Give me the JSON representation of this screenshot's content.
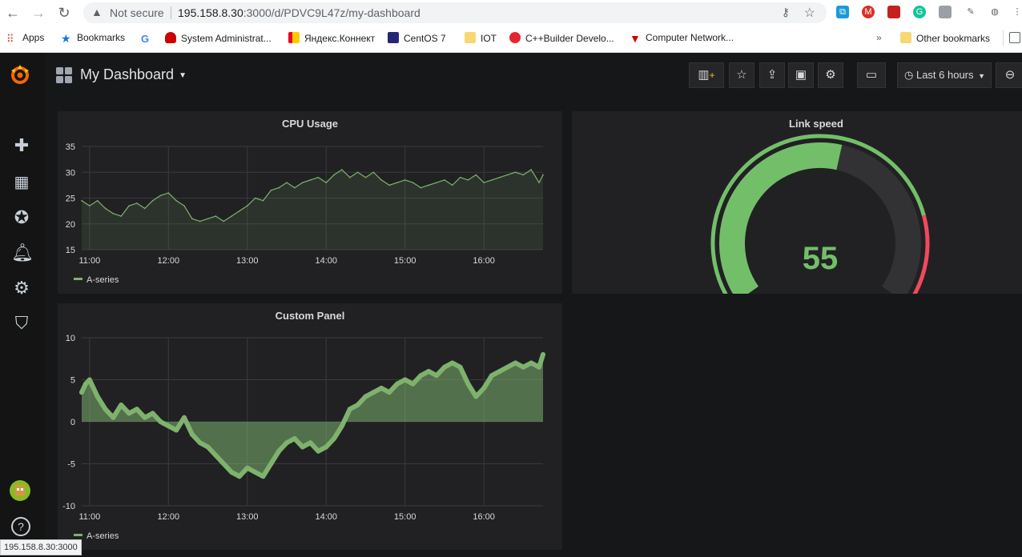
{
  "browser": {
    "security_label": "Not secure",
    "url_host": "195.158.8.30",
    "url_rest": ":3000/d/PDVC9L47z/my-dashboard",
    "bookmarks": [
      {
        "label": "Apps",
        "icon": "apps-grid-icon",
        "color": "#e8453c"
      },
      {
        "label": "Bookmarks",
        "icon": "star-icon",
        "color": "#1a73e8"
      },
      {
        "label": "",
        "icon": "google-icon",
        "color": "#4285f4"
      },
      {
        "label": "System Administrat...",
        "icon": "redhat-icon",
        "color": "#cc0000"
      },
      {
        "label": "Яндекс.Коннект",
        "icon": "yandex-icon",
        "color": "#ffcc00"
      },
      {
        "label": "CentOS 7",
        "icon": "centos-icon",
        "color": "#262577"
      },
      {
        "label": "IOT",
        "icon": "folder-icon",
        "color": "#f7d774"
      },
      {
        "label": "C++Builder Develo...",
        "icon": "embarcadero-icon",
        "color": "#e62431"
      },
      {
        "label": "Computer Network...",
        "icon": "tp-link-icon",
        "color": "#d00000"
      },
      {
        "label": "»",
        "icon": "more-bookmarks-icon",
        "color": "#5f6368"
      },
      {
        "label": "Other bookmarks",
        "icon": "folder-icon",
        "color": "#f7d774"
      }
    ],
    "status_url": "195.158.8.30:3000"
  },
  "dashboard": {
    "title": "My Dashboard",
    "time_range": "Last 6 hours"
  },
  "panels": {
    "cpu": {
      "title": "CPU Usage",
      "legend": "A-series"
    },
    "link": {
      "title": "Link speed"
    },
    "custom": {
      "title": "Custom Panel",
      "legend": "A-series"
    }
  },
  "colors": {
    "series": "#7eb26d",
    "gauge_green": "#73bf69",
    "gauge_red": "#f2495c",
    "background": "#161719",
    "panel": "#212124"
  },
  "chart_data": [
    {
      "type": "line",
      "title": "CPU Usage",
      "x_ticks": [
        "11:00",
        "12:00",
        "13:00",
        "14:00",
        "15:00",
        "16:00"
      ],
      "y_ticks": [
        "35",
        "30",
        "25",
        "20",
        "15"
      ],
      "ylim": [
        15,
        35
      ],
      "series": [
        {
          "name": "A-series",
          "x": [
            10.9,
            11.0,
            11.1,
            11.2,
            11.3,
            11.4,
            11.5,
            11.6,
            11.7,
            11.8,
            11.9,
            12.0,
            12.1,
            12.2,
            12.3,
            12.4,
            12.5,
            12.6,
            12.7,
            12.8,
            12.9,
            13.0,
            13.1,
            13.2,
            13.3,
            13.4,
            13.5,
            13.6,
            13.7,
            13.8,
            13.9,
            14.0,
            14.1,
            14.2,
            14.3,
            14.4,
            14.5,
            14.6,
            14.7,
            14.8,
            14.9,
            15.0,
            15.1,
            15.2,
            15.3,
            15.4,
            15.5,
            15.6,
            15.7,
            15.8,
            15.9,
            16.0,
            16.1,
            16.2,
            16.3,
            16.4,
            16.5,
            16.6,
            16.7,
            16.75
          ],
          "values": [
            24.5,
            23.5,
            24.5,
            23.0,
            22.0,
            21.5,
            23.5,
            24.0,
            23.0,
            24.5,
            25.5,
            26.0,
            24.5,
            23.5,
            21.0,
            20.5,
            21.0,
            21.5,
            20.5,
            21.5,
            22.5,
            23.5,
            25.0,
            24.5,
            26.5,
            27.0,
            28.0,
            27.0,
            28.0,
            28.5,
            29.0,
            28.0,
            29.5,
            30.5,
            29.0,
            30.0,
            29.0,
            30.0,
            28.5,
            27.5,
            28.0,
            28.5,
            28.0,
            27.0,
            27.5,
            28.0,
            28.5,
            27.5,
            29.0,
            28.5,
            29.5,
            28.0,
            28.5,
            29.0,
            29.5,
            30.0,
            29.5,
            30.5,
            28.0,
            29.5
          ]
        }
      ],
      "grid": true,
      "legend_position": "bottom-left"
    },
    {
      "type": "gauge",
      "title": "Link speed",
      "value": 55,
      "min": 0,
      "max": 100,
      "thresholds": [
        {
          "from": 0,
          "to": 80,
          "color": "#73bf69"
        },
        {
          "from": 80,
          "to": 100,
          "color": "#f2495c"
        }
      ]
    },
    {
      "type": "area",
      "title": "Custom Panel",
      "x_ticks": [
        "11:00",
        "12:00",
        "13:00",
        "14:00",
        "15:00",
        "16:00"
      ],
      "y_ticks": [
        "10",
        "5",
        "0",
        "-5",
        "-10"
      ],
      "ylim": [
        -10,
        10
      ],
      "series": [
        {
          "name": "A-series",
          "x": [
            10.9,
            10.95,
            11.0,
            11.05,
            11.1,
            11.2,
            11.3,
            11.4,
            11.5,
            11.6,
            11.7,
            11.8,
            11.9,
            12.0,
            12.1,
            12.2,
            12.3,
            12.4,
            12.5,
            12.6,
            12.7,
            12.8,
            12.9,
            13.0,
            13.1,
            13.2,
            13.3,
            13.4,
            13.5,
            13.6,
            13.7,
            13.8,
            13.9,
            14.0,
            14.1,
            14.2,
            14.3,
            14.4,
            14.5,
            14.6,
            14.7,
            14.8,
            14.9,
            15.0,
            15.1,
            15.2,
            15.3,
            15.4,
            15.5,
            15.6,
            15.7,
            15.8,
            15.9,
            16.0,
            16.1,
            16.2,
            16.3,
            16.4,
            16.5,
            16.6,
            16.7,
            16.75
          ],
          "values": [
            3.5,
            4.5,
            5.0,
            4.0,
            3.0,
            1.5,
            0.5,
            2.0,
            1.0,
            1.5,
            0.5,
            1.0,
            0.0,
            -0.5,
            -1.0,
            0.5,
            -1.5,
            -2.5,
            -3.0,
            -4.0,
            -5.0,
            -6.0,
            -6.5,
            -5.5,
            -6.0,
            -6.5,
            -5.0,
            -3.5,
            -2.5,
            -2.0,
            -3.0,
            -2.5,
            -3.5,
            -3.0,
            -2.0,
            -0.5,
            1.5,
            2.0,
            3.0,
            3.5,
            4.0,
            3.5,
            4.5,
            5.0,
            4.5,
            5.5,
            6.0,
            5.5,
            6.5,
            7.0,
            6.5,
            4.5,
            3.0,
            4.0,
            5.5,
            6.0,
            6.5,
            7.0,
            6.5,
            7.0,
            6.5,
            8.0
          ]
        }
      ],
      "grid": true,
      "legend_position": "bottom-left"
    }
  ]
}
